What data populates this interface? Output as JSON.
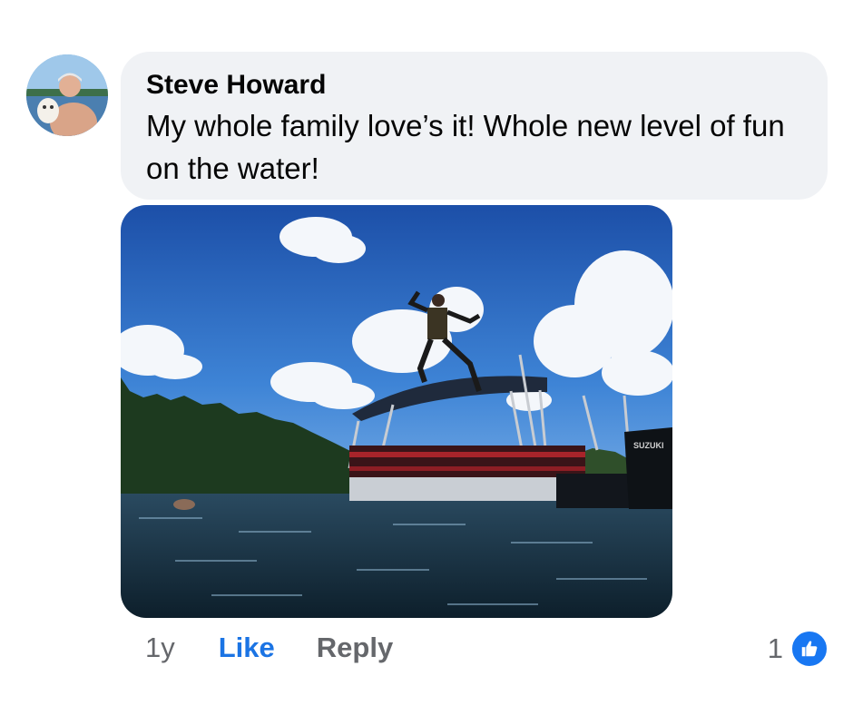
{
  "comment": {
    "author": "Steve Howard",
    "text": "My whole family love’s it! Whole new level of fun on the water!",
    "timestamp": "1y",
    "like_label": "Like",
    "reply_label": "Reply",
    "reaction_count": "1",
    "reaction_icon": "thumbs-up-icon",
    "photo_logo_text": "SUZUKI"
  },
  "colors": {
    "bubble_bg": "#f0f2f5",
    "like_blue": "#1b74e4",
    "muted": "#65676b",
    "reaction_blue": "#1877f2"
  }
}
